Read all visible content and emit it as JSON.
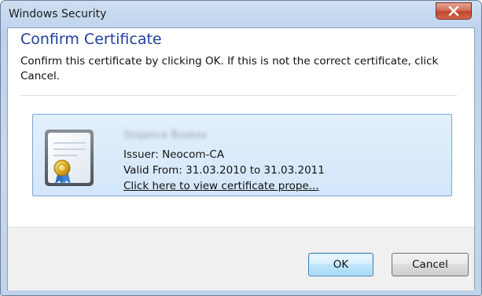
{
  "window": {
    "title": "Windows Security"
  },
  "dialog": {
    "heading": "Confirm Certificate",
    "instruction": "Confirm this certificate by clicking OK. If this is not the correct certificate, click Cancel."
  },
  "certificate": {
    "subject_name": "Stojance Boskov",
    "issuer": "Issuer: Neocom-CA",
    "valid": "Valid From: 31.03.2010 to 31.03.2011",
    "link_label": "Click here to view certificate prope..."
  },
  "buttons": {
    "ok_label": "OK",
    "cancel_label": "Cancel"
  },
  "colors": {
    "heading": "#1e3f9b",
    "tile_border": "#7ca6d8",
    "close_button": "#c04428"
  },
  "icons": {
    "close": "close-icon",
    "certificate": "certificate-icon"
  }
}
